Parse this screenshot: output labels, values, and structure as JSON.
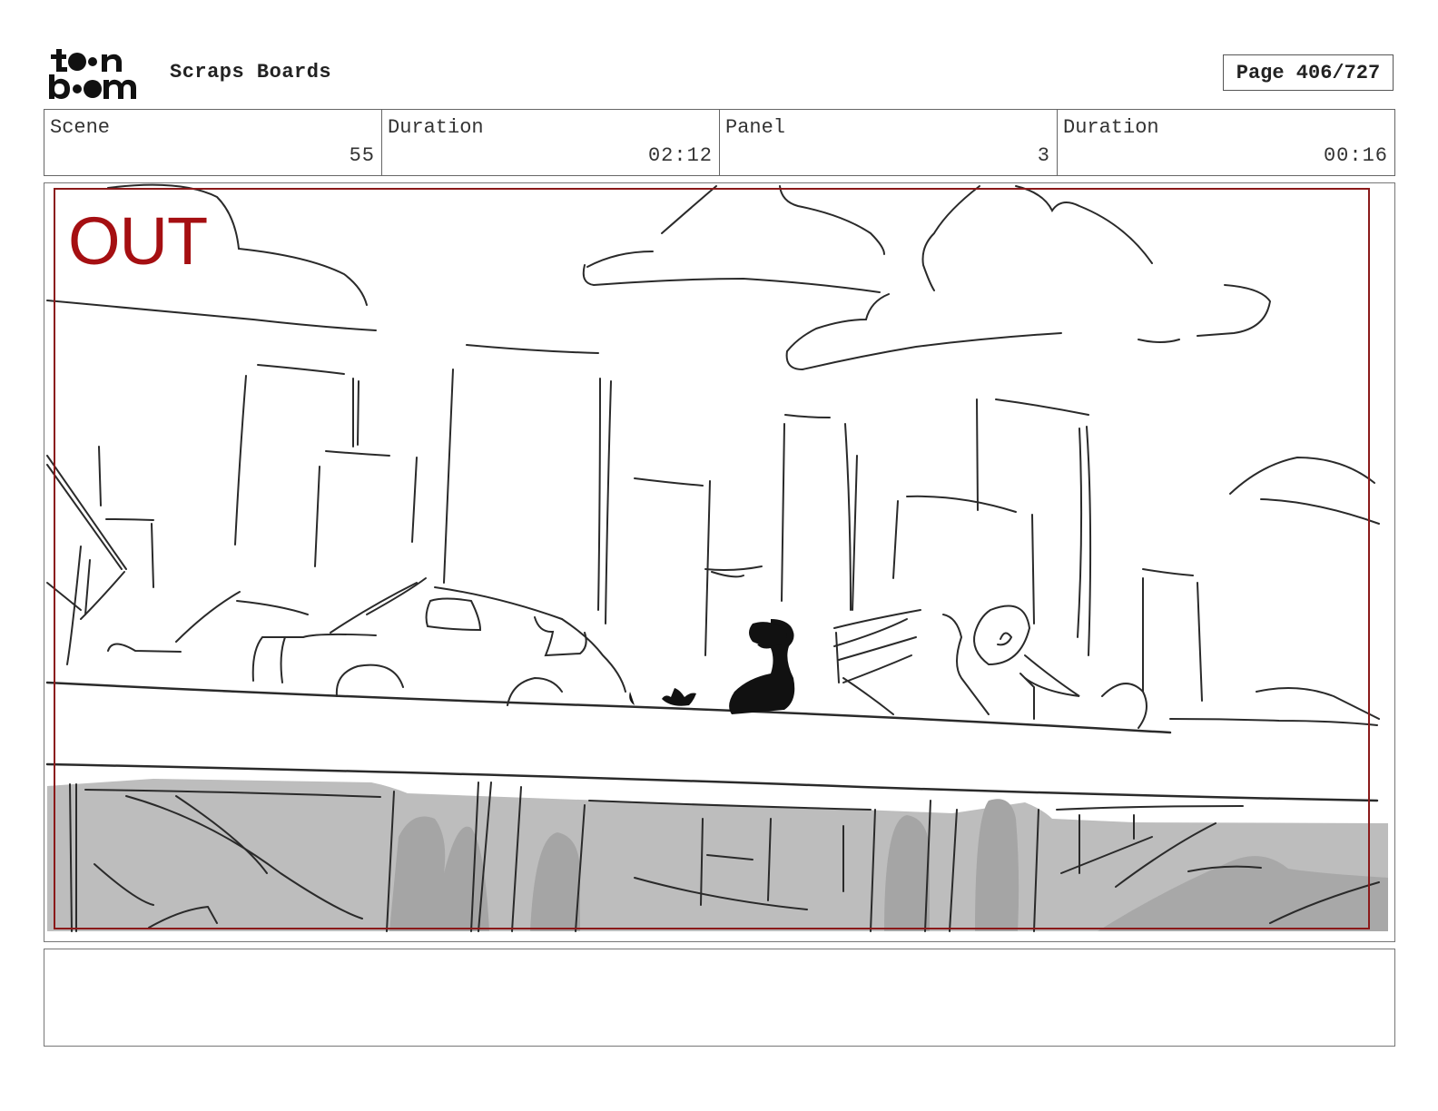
{
  "header": {
    "logo_text": "toon boom",
    "title": "Scraps Boards",
    "page_label": "Page 406/727"
  },
  "info": {
    "scene_label": "Scene",
    "scene_value": "55",
    "scene_duration_label": "Duration",
    "scene_duration_value": "02:12",
    "panel_label": "Panel",
    "panel_value": "3",
    "panel_duration_label": "Duration",
    "panel_duration_value": "00:16"
  },
  "panel": {
    "annotation": "OUT",
    "annotation_color": "#a50f12"
  },
  "notes": {
    "text": ""
  }
}
